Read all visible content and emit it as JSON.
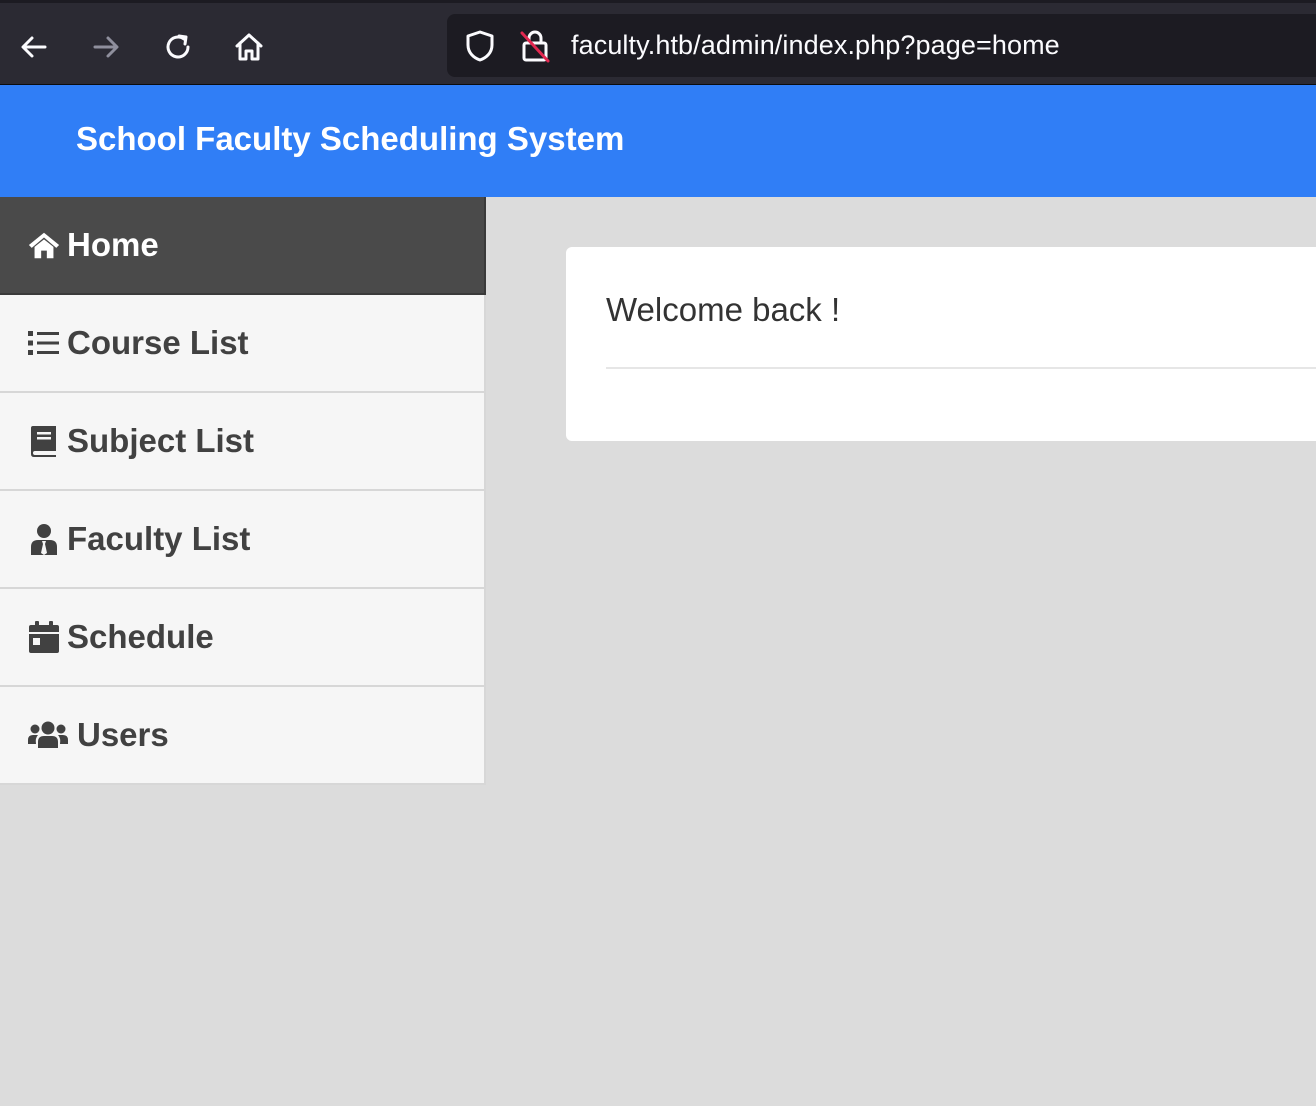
{
  "browser": {
    "url": "faculty.htb/admin/index.php?page=home",
    "icons": {
      "back": "arrow-left-icon",
      "forward": "arrow-right-icon",
      "reload": "reload-icon",
      "home": "home-icon",
      "shield": "shield-icon",
      "insecure_lock": "insecure-lock-icon"
    }
  },
  "header": {
    "title": "School Faculty Scheduling System",
    "color": "#307ef6"
  },
  "sidebar": {
    "items": [
      {
        "label": "Home",
        "icon": "home-icon",
        "active": true
      },
      {
        "label": "Course List",
        "icon": "list-icon",
        "active": false
      },
      {
        "label": "Subject List",
        "icon": "book-icon",
        "active": false
      },
      {
        "label": "Faculty List",
        "icon": "user-tie-icon",
        "active": false
      },
      {
        "label": "Schedule",
        "icon": "calendar-icon",
        "active": false
      },
      {
        "label": "Users",
        "icon": "users-icon",
        "active": false
      }
    ]
  },
  "main": {
    "welcome": "Welcome back !"
  }
}
